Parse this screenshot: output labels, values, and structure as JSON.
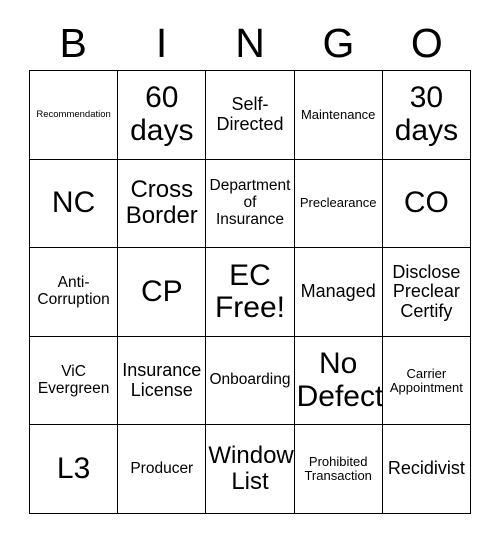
{
  "card": {
    "title": "BINGO",
    "header_letters": [
      "B",
      "I",
      "N",
      "G",
      "O"
    ],
    "colors": {
      "background": "#ffffff",
      "border": "#000000",
      "text": "#000000"
    },
    "rows": [
      [
        {
          "text": "Recommendation",
          "size": "xs"
        },
        {
          "text": "60\ndays",
          "size": "xxl"
        },
        {
          "text": "Self-\nDirected",
          "size": "l"
        },
        {
          "text": "Maintenance",
          "size": "s"
        },
        {
          "text": "30\ndays",
          "size": "xxl"
        }
      ],
      [
        {
          "text": "NC",
          "size": "xxl"
        },
        {
          "text": "Cross\nBorder",
          "size": "xl"
        },
        {
          "text": "Department\nof\nInsurance",
          "size": "m"
        },
        {
          "text": "Preclearance",
          "size": "s"
        },
        {
          "text": "CO",
          "size": "xxl"
        }
      ],
      [
        {
          "text": "Anti-\nCorruption",
          "size": "m"
        },
        {
          "text": "CP",
          "size": "xxl"
        },
        {
          "text": "EC\nFree!",
          "size": "xxl"
        },
        {
          "text": "Managed",
          "size": "l"
        },
        {
          "text": "Disclose\nPreclear\nCertify",
          "size": "l"
        }
      ],
      [
        {
          "text": "ViC\nEvergreen",
          "size": "m"
        },
        {
          "text": "Insurance\nLicense",
          "size": "l"
        },
        {
          "text": "Onboarding",
          "size": "m"
        },
        {
          "text": "No\nDefect",
          "size": "xxl"
        },
        {
          "text": "Carrier\nAppointment",
          "size": "s"
        }
      ],
      [
        {
          "text": "L3",
          "size": "xxl"
        },
        {
          "text": "Producer",
          "size": "m"
        },
        {
          "text": "Window\nList",
          "size": "xl"
        },
        {
          "text": "Prohibited\nTransaction",
          "size": "s"
        },
        {
          "text": "Recidivist",
          "size": "l"
        }
      ]
    ]
  }
}
